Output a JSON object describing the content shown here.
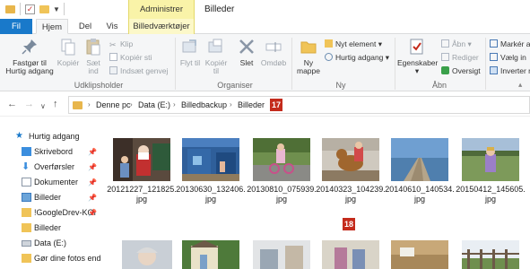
{
  "window": {
    "title": "Billeder",
    "context_tab_header": "Administrer"
  },
  "tabs": [
    {
      "label": "Fil"
    },
    {
      "label": "Hjem"
    },
    {
      "label": "Del"
    },
    {
      "label": "Vis"
    },
    {
      "label": "Billedværktøjer"
    }
  ],
  "ribbon": {
    "clipboard": {
      "pin_label": "Fastgør til Hurtig adgang",
      "copy_label": "Kopiér",
      "paste_label": "Sæt ind",
      "cut_label": "Klip",
      "copy_path_label": "Kopiér sti",
      "paste_shortcut_label": "Indsæt genvej",
      "group_label": "Udklipsholder"
    },
    "organize": {
      "move_label": "Flyt til",
      "copy_to_label": "Kopiér til",
      "delete_label": "Slet",
      "rename_label": "Omdøb",
      "group_label": "Organiser"
    },
    "new": {
      "new_folder_label": "Ny mappe",
      "new_item_label": "Nyt element",
      "easy_access_label": "Hurtig adgang",
      "group_label": "Ny"
    },
    "open": {
      "properties_label": "Egenskaber",
      "open_label": "Åbn",
      "edit_label": "Rediger",
      "history_label": "Oversigt",
      "group_label": "Åbn"
    },
    "select": {
      "select_all_label": "Markér a",
      "select_none_label": "Vælg in",
      "invert_label": "Inverter m"
    }
  },
  "address": {
    "crumbs": [
      "Denne pc",
      "Data (E:)",
      "Billedbackup",
      "Billeder"
    ],
    "badge": "17"
  },
  "sidebar": {
    "items": [
      {
        "label": "Hurtig adgang",
        "pinned": false
      },
      {
        "label": "Skrivebord",
        "pinned": true
      },
      {
        "label": "Overførsler",
        "pinned": true
      },
      {
        "label": "Dokumenter",
        "pinned": true
      },
      {
        "label": "Billeder",
        "pinned": true
      },
      {
        "label": "!GoogleDrev-KOI",
        "pinned": true
      },
      {
        "label": "Billeder",
        "pinned": false
      },
      {
        "label": "Data (E:)",
        "pinned": false
      },
      {
        "label": "Gør dine fotos endr",
        "pinned": false
      }
    ]
  },
  "files": [
    {
      "name_line1": "20121227_121825.",
      "name_line2": "jpg"
    },
    {
      "name_line1": "20130630_132406.",
      "name_line2": "jpg"
    },
    {
      "name_line1": "20130810_075939.",
      "name_line2": "jpg"
    },
    {
      "name_line1": "20140323_104239.",
      "name_line2": "jpg"
    },
    {
      "name_line1": "20140610_140534.",
      "name_line2": "jpg"
    },
    {
      "name_line1": "20150412_145605.",
      "name_line2": "jpg"
    }
  ],
  "content_badge": "18",
  "colors": {
    "accent": "#1979ca",
    "context_tab": "#f9f3a8",
    "badge": "#c42b1c",
    "folder": "#e8b64c"
  }
}
